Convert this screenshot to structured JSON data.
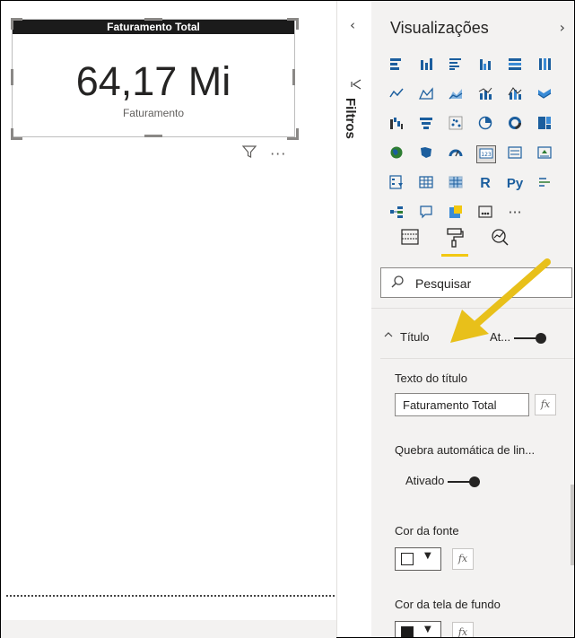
{
  "canvas": {
    "card": {
      "title": "Faturamento Total",
      "value": "64,17 Mi",
      "label": "Faturamento"
    },
    "filter_icon": "filter-icon",
    "more_icon": "more-options-icon"
  },
  "filters_pane": {
    "label": "Filtros",
    "collapse_icon": "chevron-left-icon",
    "filter_icon": "funnel-icon"
  },
  "visualizations": {
    "title": "Visualizações",
    "expand_icon": "chevron-right-icon",
    "tabs": [
      {
        "name": "fields-tab",
        "icon": "fields-icon"
      },
      {
        "name": "format-tab",
        "icon": "paint-roller-icon"
      },
      {
        "name": "analytics-tab",
        "icon": "analytics-icon"
      }
    ],
    "search": {
      "placeholder": "Pesquisar"
    },
    "section": {
      "title": "Título",
      "toggle_label": "At...",
      "state": "on"
    },
    "properties": {
      "title_text_label": "Texto do título",
      "title_text_value": "Faturamento Total",
      "word_wrap_label": "Quebra automática de lin...",
      "word_wrap_toggle": "Ativado",
      "font_color_label": "Cor da fonte",
      "background_label": "Cor da tela de fundo",
      "fx_label": "fx"
    },
    "accent_color": "#f2c811"
  }
}
